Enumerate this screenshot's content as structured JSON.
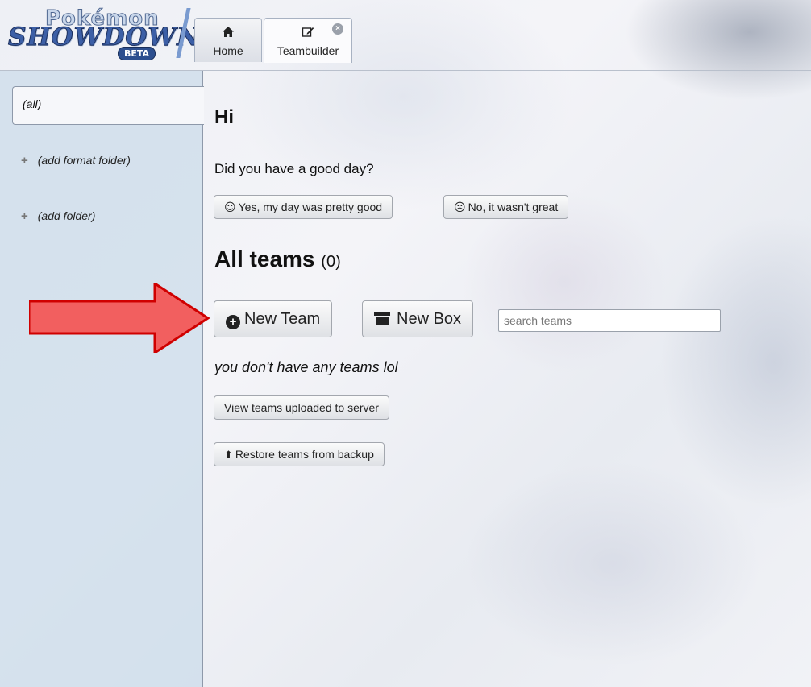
{
  "logo": {
    "top": "Pokémon",
    "main": "SHOWDOWN",
    "badge": "BETA"
  },
  "tabs": [
    {
      "label": "Home",
      "icon": "home-icon"
    },
    {
      "label": "Teambuilder",
      "icon": "edit-icon",
      "closable": true
    }
  ],
  "sidebar": {
    "folders": [
      {
        "label": "(all)",
        "selected": true
      },
      {
        "label": "(add format folder)",
        "icon": "plus-icon"
      },
      {
        "label": "(add folder)",
        "icon": "plus-icon"
      }
    ]
  },
  "greeting": {
    "title": "Hi",
    "question": "Did you have a good day?",
    "yes_button": "Yes, my day was pretty good",
    "no_button": "No, it wasn't great"
  },
  "teams": {
    "title": "All teams",
    "count": "(0)",
    "new_team_button": "New Team",
    "new_box_button": "New Box",
    "search_placeholder": "search teams",
    "empty_message": "you don't have any teams lol",
    "view_uploaded_button": "View teams uploaded to server",
    "restore_button": "Restore teams from backup"
  },
  "colors": {
    "arrow_fill": "#f25f5f",
    "arrow_stroke": "#d00000",
    "sidebar_bg": "#cdddeb"
  }
}
